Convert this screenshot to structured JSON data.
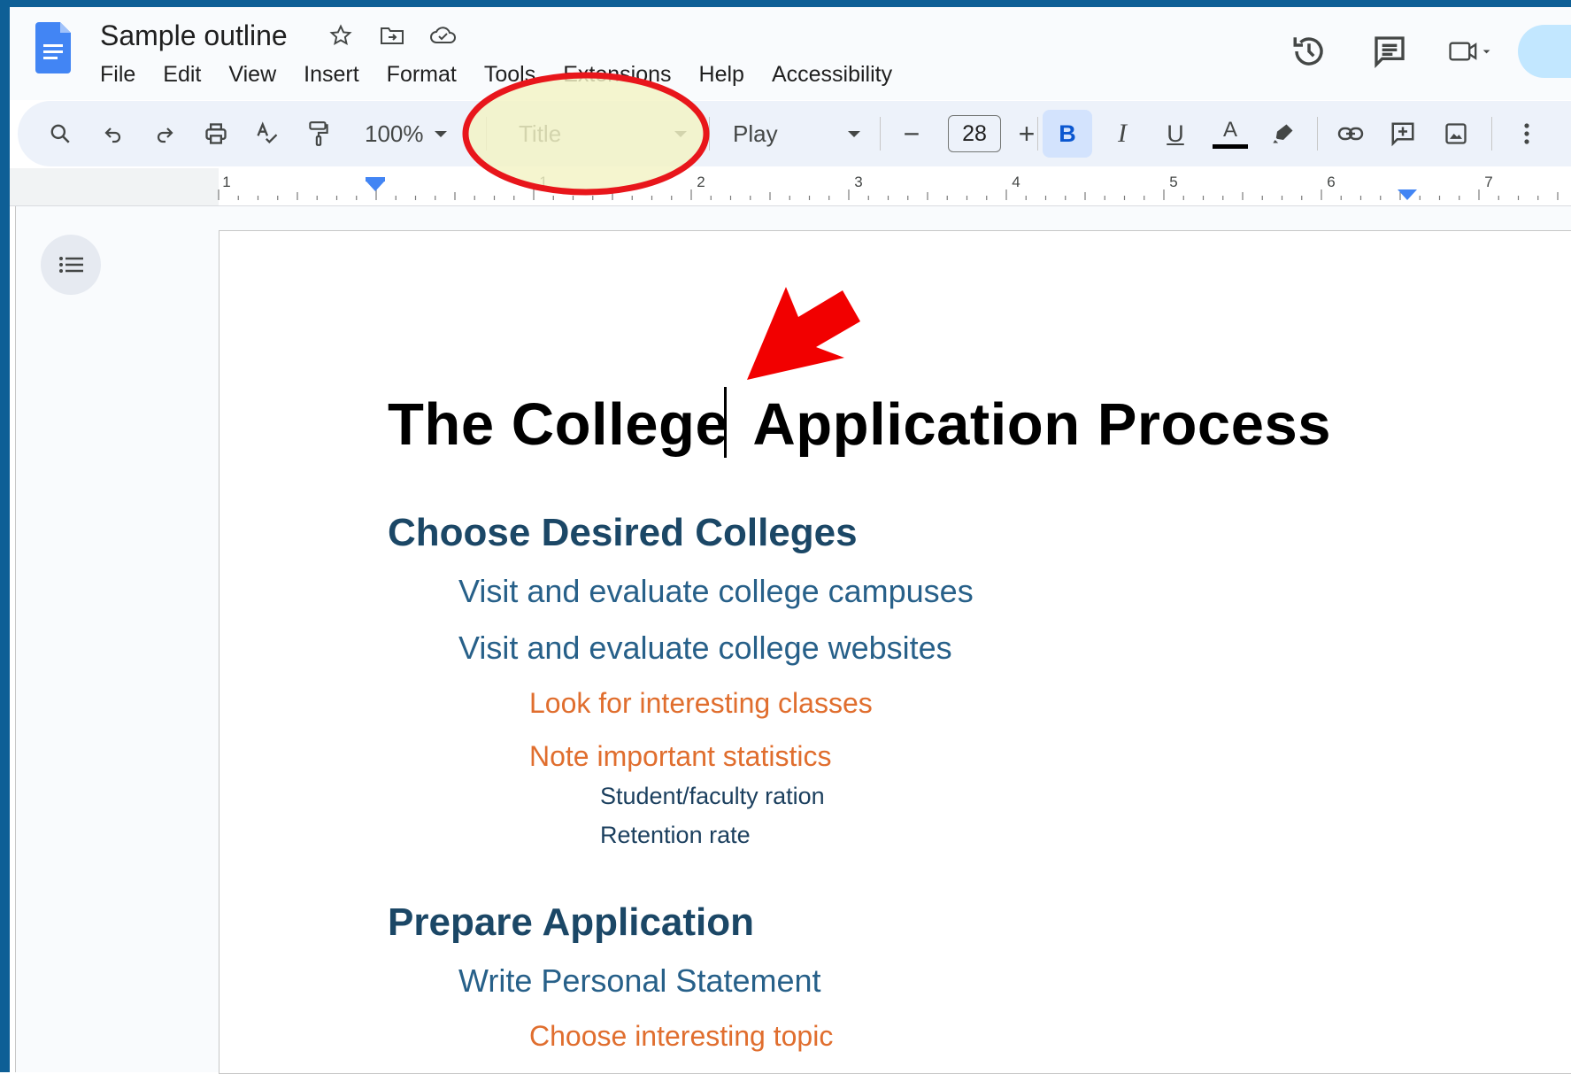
{
  "app": {
    "doc_title": "Sample outline",
    "icons": [
      "docs-logo-icon",
      "star-icon",
      "move-folder-icon",
      "cloud-saved-icon"
    ]
  },
  "menu": [
    "File",
    "Edit",
    "View",
    "Insert",
    "Format",
    "Tools",
    "Extensions",
    "Help",
    "Accessibility"
  ],
  "header_icons": [
    "version-history-icon",
    "comments-icon",
    "meet-icon"
  ],
  "toolbar": {
    "zoom": "100%",
    "style": "Title",
    "font": "Play",
    "font_size": "28",
    "bold_label": "B",
    "italic_label": "I",
    "underline_label": "U",
    "text_color_label": "A",
    "minus_label": "−",
    "plus_label": "+"
  },
  "ruler": {
    "marks": [
      "1",
      "1",
      "2",
      "3",
      "4",
      "5",
      "6",
      "7"
    ]
  },
  "document": {
    "title": "The College Application Process",
    "title_part1": "The College",
    "title_part2": "Application Process",
    "sections": [
      {
        "heading": "Choose Desired Colleges",
        "items": [
          {
            "level": 2,
            "text": "Visit and evaluate college campuses"
          },
          {
            "level": 2,
            "text": "Visit and evaluate college websites"
          },
          {
            "level": 3,
            "text": "Look for interesting classes"
          },
          {
            "level": 3,
            "text": "Note important statistics"
          },
          {
            "level": 4,
            "text": "Student/faculty ration"
          },
          {
            "level": 4,
            "text": "Retention rate"
          }
        ]
      },
      {
        "heading": "Prepare Application",
        "items": [
          {
            "level": 2,
            "text": "Write Personal Statement"
          },
          {
            "level": 3,
            "text": "Choose interesting topic"
          }
        ]
      }
    ]
  },
  "annotation": {
    "highlight_color": "#f3f3c4",
    "ring_color": "#e8161b",
    "arrow_color": "#f20000"
  }
}
